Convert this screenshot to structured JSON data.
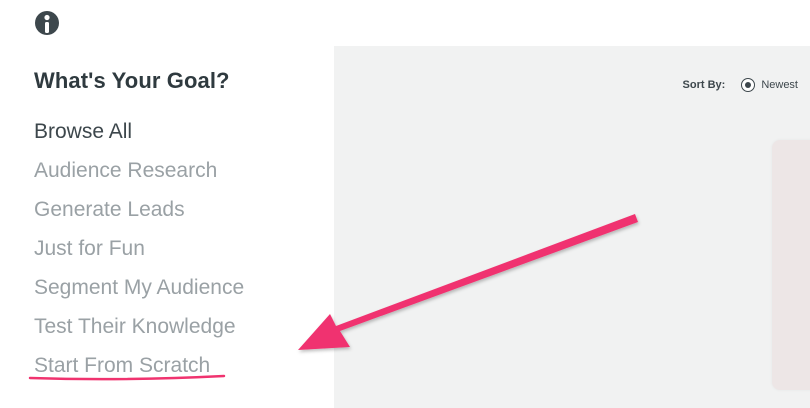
{
  "logo": {
    "icon": "brand-logo-icon"
  },
  "sidebar": {
    "title": "What's Your Goal?",
    "items": [
      {
        "label": "Browse All",
        "active": true
      },
      {
        "label": "Audience Research"
      },
      {
        "label": "Generate Leads"
      },
      {
        "label": "Just for Fun"
      },
      {
        "label": "Segment My Audience"
      },
      {
        "label": "Test Their Knowledge"
      },
      {
        "label": "Start From Scratch"
      }
    ]
  },
  "sort": {
    "label": "Sort By:",
    "selected_option": "Newest"
  },
  "colors": {
    "annotation": "#f0336f",
    "active_text": "#3d474c",
    "inactive_text": "#9aa1a5",
    "content_bg": "#f1f2f2"
  }
}
